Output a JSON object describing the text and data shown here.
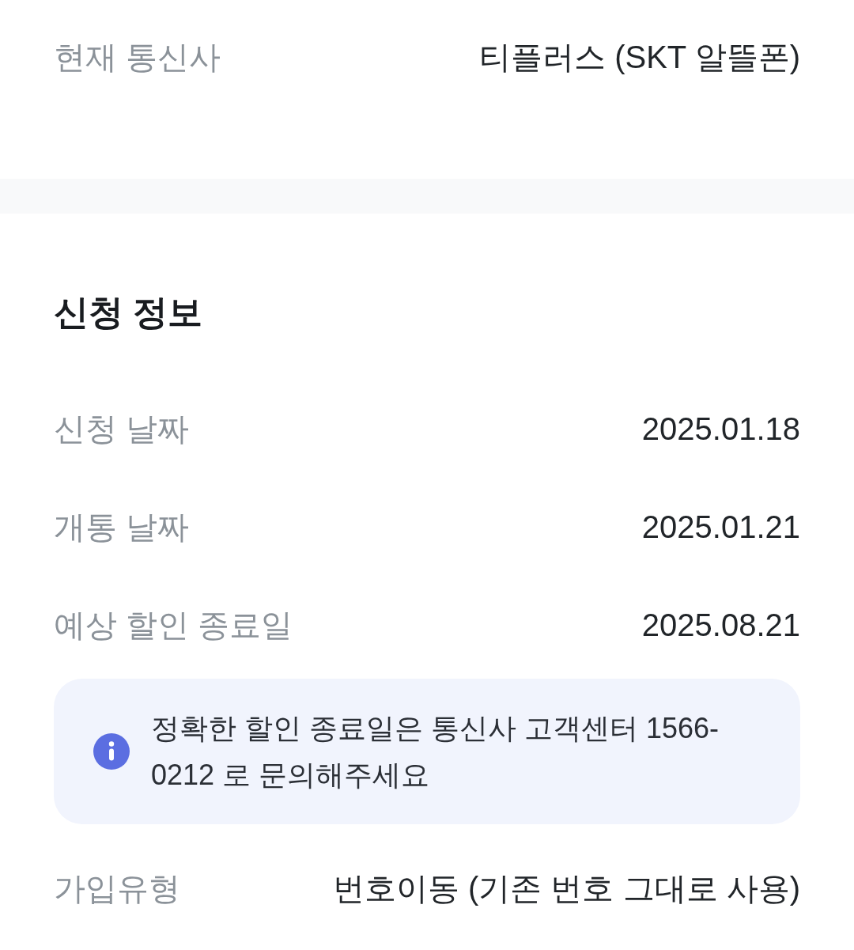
{
  "sections": [
    {
      "rows": [
        {
          "kind": "field",
          "label": "현재 통신사",
          "value": "티플러스 (SKT 알뜰폰)"
        }
      ]
    },
    {
      "title": "신청 정보",
      "rows": [
        {
          "kind": "field",
          "label": "신청 날짜",
          "value": "2025.01.18"
        },
        {
          "kind": "field",
          "label": "개통 날짜",
          "value": "2025.01.21"
        },
        {
          "kind": "field",
          "label": "예상 할인 종료일",
          "value": "2025.08.21"
        },
        {
          "kind": "notice",
          "text": "정확한 할인 종료일은 통신사 고객센터 1566-0212 로 문의해주세요"
        },
        {
          "kind": "field",
          "label": "가입유형",
          "value": "번호이동 (기존 번호 그대로 사용)"
        }
      ]
    }
  ]
}
